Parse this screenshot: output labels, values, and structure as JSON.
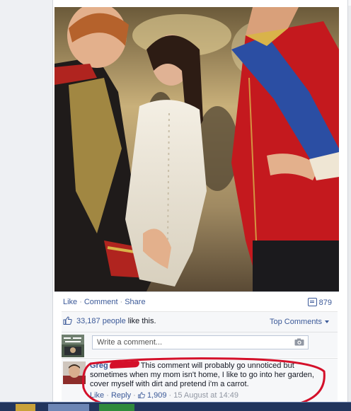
{
  "post": {
    "actions": {
      "like": "Like",
      "comment": "Comment",
      "share": "Share"
    },
    "comment_count": "879"
  },
  "feedback": {
    "likes_link": "33,187 people",
    "likes_suffix": " like this.",
    "sort_label": "Top Comments",
    "compose_placeholder": "Write a comment..."
  },
  "comment": {
    "author": "Greg",
    "text": "This comment will probably go unnoticed but sometimes when my mom isn't home, I like to go into her garden, cover myself with dirt and pretend i'm a carrot.",
    "like_label": "Like",
    "reply_label": "Reply",
    "like_count": "1,909",
    "timestamp": "15 August at 14:49",
    "separator": " · "
  },
  "icons": {
    "comment_icon": "comment-bubble-icon",
    "like_icon": "thumbs-up-icon",
    "camera_icon": "camera-icon"
  },
  "colors": {
    "link": "#3b5998",
    "highlight": "#d4102a",
    "taskbar": "#22355d"
  }
}
